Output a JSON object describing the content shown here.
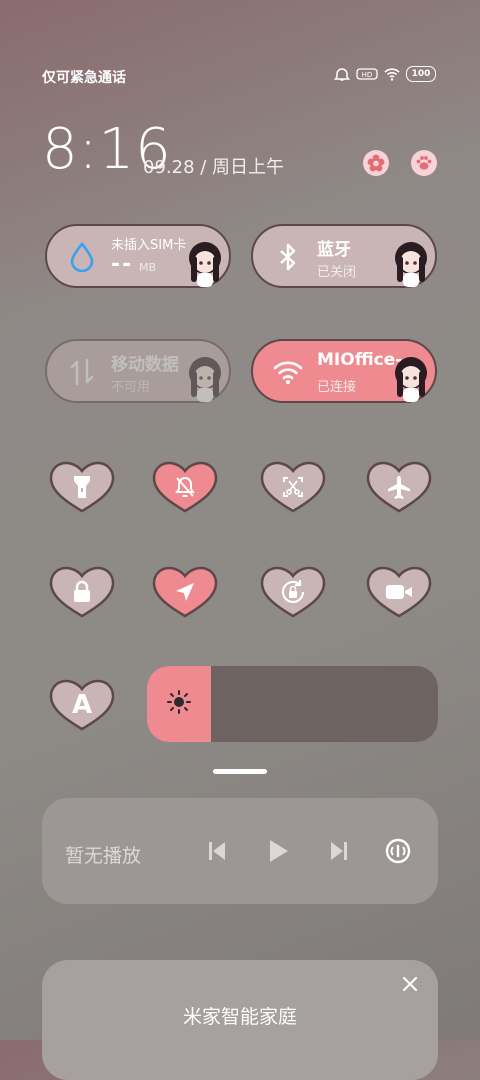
{
  "status_bar": {
    "carrier_text": "仅可紧急通话",
    "battery": "100",
    "icons": [
      "alarm-icon",
      "hd-icon",
      "wifi-icon",
      "battery-icon"
    ]
  },
  "clock": {
    "time": "8:16",
    "date": "09.28 / 周日上午"
  },
  "header_buttons": [
    "flower-settings-icon",
    "paw-edit-icon"
  ],
  "tiles": [
    {
      "title": "未插入SIM卡",
      "value": "--",
      "unit": "MB",
      "icon": "water-drop-icon",
      "state": "normal"
    },
    {
      "title": "蓝牙",
      "sub": "已关闭",
      "icon": "bluetooth-icon",
      "state": "normal"
    },
    {
      "title": "移动数据",
      "sub": "不可用",
      "icon": "data-arrows-icon",
      "state": "disabled"
    },
    {
      "title": "MIOffice-",
      "sub": "已连接",
      "icon": "wifi-icon",
      "state": "active"
    }
  ],
  "toggles": [
    {
      "icon": "flashlight-icon",
      "active": false
    },
    {
      "icon": "mute-bell-icon",
      "active": true
    },
    {
      "icon": "screenshot-icon",
      "active": false
    },
    {
      "icon": "airplane-icon",
      "active": false
    },
    {
      "icon": "lock-icon",
      "active": false
    },
    {
      "icon": "location-icon",
      "active": true
    },
    {
      "icon": "rotation-lock-icon",
      "active": false
    },
    {
      "icon": "video-camera-icon",
      "active": false
    },
    {
      "icon": "auto-brightness-icon",
      "label": "A",
      "active": false
    }
  ],
  "brightness": {
    "level": 0.22,
    "icon": "sun-icon"
  },
  "media": {
    "label": "暂无播放",
    "controls": [
      "previous-icon",
      "play-icon",
      "next-icon",
      "cast-icon"
    ]
  },
  "smart_home": {
    "title": "米家智能家庭",
    "close": "close-icon"
  },
  "colors": {
    "accent_pink": "#ee8a90",
    "tile_base": "#c9b4b6",
    "outline": "#5d4849"
  }
}
